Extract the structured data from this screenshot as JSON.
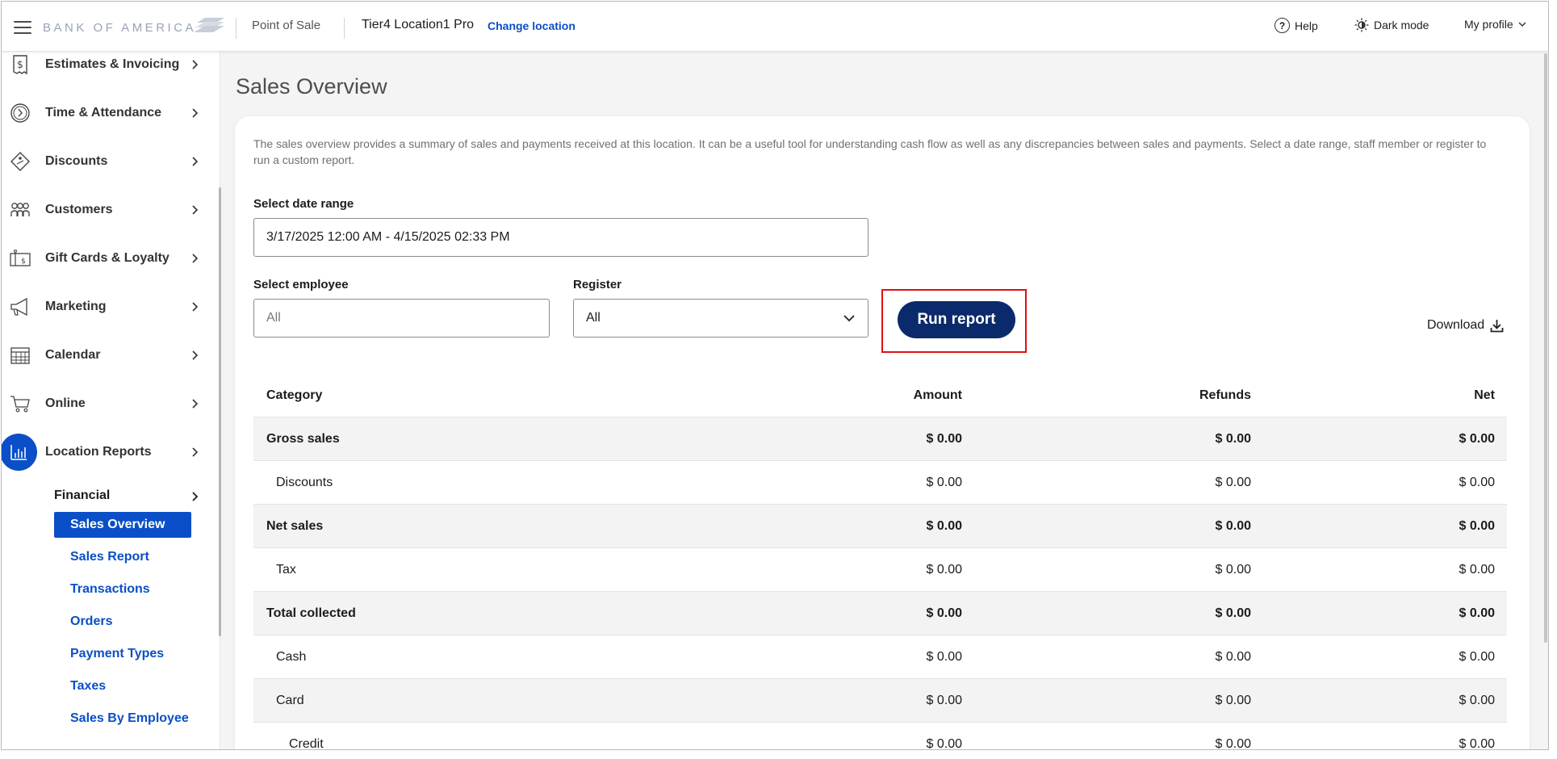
{
  "header": {
    "brand": "BANK OF AMERICA",
    "product": "Point of Sale",
    "location": "Tier4 Location1 Pro",
    "change_location": "Change location",
    "help": "Help",
    "dark_mode": "Dark mode",
    "profile": "My profile"
  },
  "sidebar": {
    "items": [
      {
        "label": "Estimates & Invoicing",
        "icon": "invoice-icon"
      },
      {
        "label": "Time & Attendance",
        "icon": "clock-icon"
      },
      {
        "label": "Discounts",
        "icon": "tag-icon"
      },
      {
        "label": "Customers",
        "icon": "people-icon"
      },
      {
        "label": "Gift Cards & Loyalty",
        "icon": "gift-card-icon"
      },
      {
        "label": "Marketing",
        "icon": "megaphone-icon"
      },
      {
        "label": "Calendar",
        "icon": "calendar-icon"
      },
      {
        "label": "Online",
        "icon": "cart-icon"
      },
      {
        "label": "Location Reports",
        "icon": "bar-chart-icon"
      }
    ],
    "submenu_title": "Financial",
    "submenu": [
      {
        "label": "Sales Overview",
        "active": true
      },
      {
        "label": "Sales Report"
      },
      {
        "label": "Transactions"
      },
      {
        "label": "Orders"
      },
      {
        "label": "Payment Types"
      },
      {
        "label": "Taxes"
      },
      {
        "label": "Sales By Employee"
      }
    ]
  },
  "main": {
    "title": "Sales Overview",
    "description": "The sales overview provides a summary of sales and payments received at this location. It can be a useful tool for understanding cash flow as well as any discrepancies between sales and payments. Select a date range, staff member or register to run a custom report.",
    "date_range_label": "Select date range",
    "date_range_value": "3/17/2025 12:00 AM - 4/15/2025 02:33 PM",
    "employee_label": "Select employee",
    "employee_placeholder": "All",
    "register_label": "Register",
    "register_value": "All",
    "run_report": "Run report",
    "download": "Download"
  },
  "table": {
    "columns": [
      "Category",
      "Amount",
      "Refunds",
      "Net"
    ],
    "rows": [
      {
        "category": "Gross sales",
        "amount": "$ 0.00",
        "refunds": "$ 0.00",
        "net": "$ 0.00",
        "bold": true,
        "indent": 0,
        "shade": true
      },
      {
        "category": "Discounts",
        "amount": "$ 0.00",
        "refunds": "$ 0.00",
        "net": "$ 0.00",
        "bold": false,
        "indent": 1,
        "shade": false
      },
      {
        "category": "Net sales",
        "amount": "$ 0.00",
        "refunds": "$ 0.00",
        "net": "$ 0.00",
        "bold": true,
        "indent": 0,
        "shade": true
      },
      {
        "category": "Tax",
        "amount": "$ 0.00",
        "refunds": "$ 0.00",
        "net": "$ 0.00",
        "bold": false,
        "indent": 1,
        "shade": false
      },
      {
        "category": "Total collected",
        "amount": "$ 0.00",
        "refunds": "$ 0.00",
        "net": "$ 0.00",
        "bold": true,
        "indent": 0,
        "shade": true
      },
      {
        "category": "Cash",
        "amount": "$ 0.00",
        "refunds": "$ 0.00",
        "net": "$ 0.00",
        "bold": false,
        "indent": 1,
        "shade": false
      },
      {
        "category": "Card",
        "amount": "$ 0.00",
        "refunds": "$ 0.00",
        "net": "$ 0.00",
        "bold": false,
        "indent": 1,
        "shade": true
      },
      {
        "category": "Credit",
        "amount": "$ 0.00",
        "refunds": "$ 0.00",
        "net": "$ 0.00",
        "bold": false,
        "indent": 2,
        "shade": false
      }
    ]
  },
  "colors": {
    "accent": "#0a4fc7",
    "run_button": "#0b2a6b",
    "highlight_outline": "#e01010"
  }
}
